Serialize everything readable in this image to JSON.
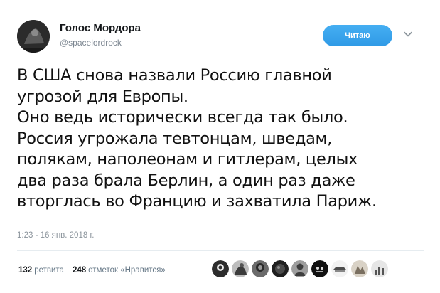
{
  "author": {
    "name": "Голос Мордора",
    "handle": "@spacelordrock"
  },
  "follow_button": {
    "label": "Читаю"
  },
  "tweet": {
    "lines": [
      "В США снова назвали Россию главной",
      "угрозой для Европы.",
      "Оно ведь исторически всегда так было.",
      "Россия угрожала тевтонцам, шведам,",
      "полякам, наполеонам и гитлерам, целых",
      "два раза брала Берлин, а один раз даже",
      "вторглась во Францию и захватила Париж."
    ],
    "timestamp": "1:23 - 16 янв. 2018 г."
  },
  "stats": {
    "retweets_count": "132",
    "retweets_label": "ретвита",
    "likes_count": "248",
    "likes_label": "отметок «Нравится»"
  },
  "liker_avatars": [
    "liker-avatar-1",
    "liker-avatar-2",
    "liker-avatar-3",
    "liker-avatar-4",
    "liker-avatar-5",
    "liker-avatar-6",
    "liker-avatar-7",
    "liker-avatar-8",
    "liker-avatar-9"
  ]
}
